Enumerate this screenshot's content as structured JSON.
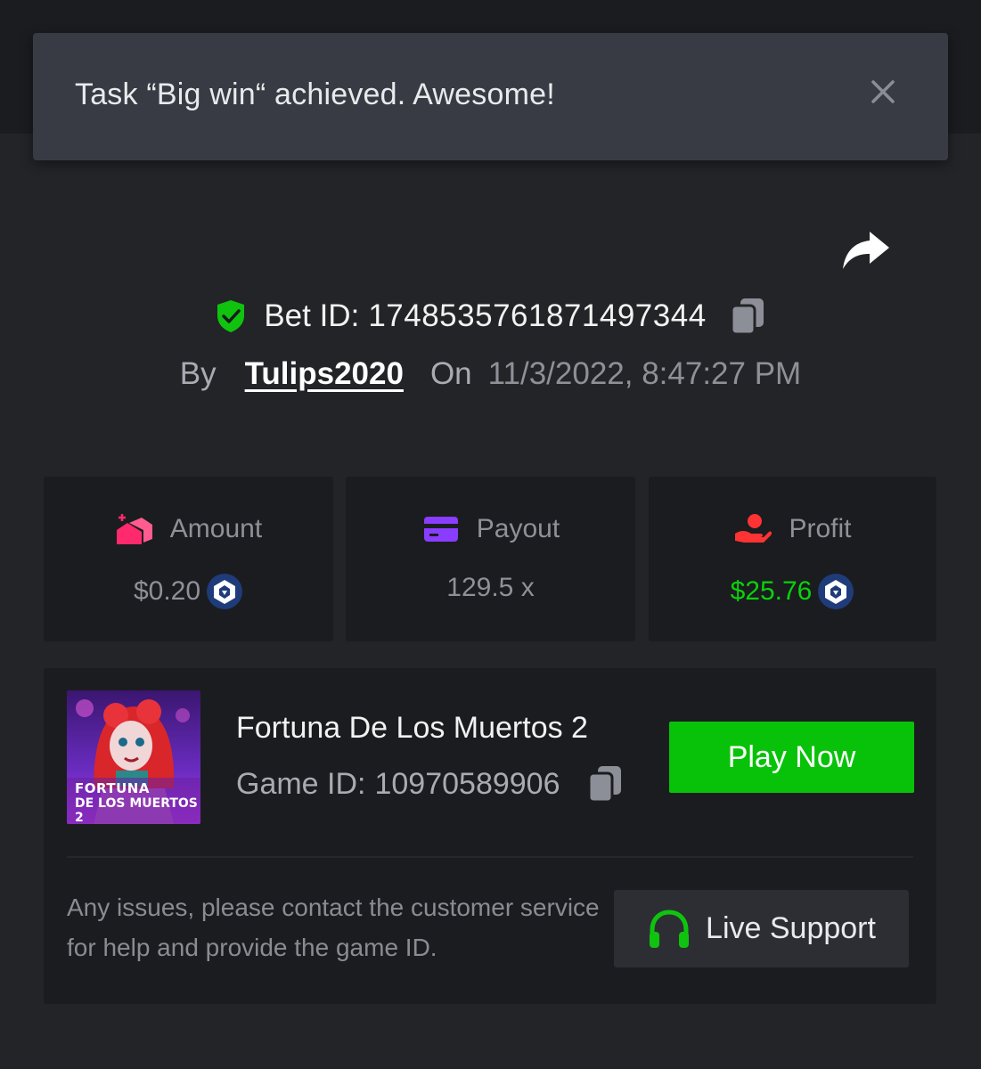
{
  "toast": {
    "message": "Task “Big win“ achieved. Awesome!",
    "close_icon": "close-icon"
  },
  "share_icon": "share-icon",
  "bet": {
    "label": "Bet ID:",
    "id": "1748535761871497344",
    "verified_icon": "shield-check-icon",
    "copy_icon": "copy-icon"
  },
  "byline": {
    "by_label": "By",
    "username": "Tulips2020",
    "on_label": "On",
    "datetime": "11/3/2022, 8:47:27 PM"
  },
  "stats": {
    "amount": {
      "label": "Amount",
      "value": "$0.20",
      "icon": "coins-icon",
      "coin_icon": "currency-coin-icon"
    },
    "payout": {
      "label": "Payout",
      "value": "129.5 x",
      "icon": "card-icon"
    },
    "profit": {
      "label": "Profit",
      "value": "$25.76",
      "icon": "hand-coin-icon",
      "coin_icon": "currency-coin-icon"
    }
  },
  "game": {
    "title": "Fortuna De Los Muertos 2",
    "id_label": "Game ID:",
    "id": "10970589906",
    "thumb_text_line1": "FORTUNA",
    "thumb_text_line2": "DE LOS MUERTOS 2",
    "play_label": "Play Now"
  },
  "support": {
    "help_text": "Any issues, please contact the customer service for help and provide the game ID.",
    "button_label": "Live Support",
    "icon": "headset-icon"
  },
  "colors": {
    "accent_green": "#08c20a",
    "profit_green": "#0bd10b",
    "background": "#232427",
    "card": "#1b1c1f",
    "toast": "#393b44",
    "amount_icon": "#ff2a6d",
    "payout_icon": "#8a3cff",
    "profit_icon": "#ff3333",
    "coin": "#1f3b7a"
  }
}
